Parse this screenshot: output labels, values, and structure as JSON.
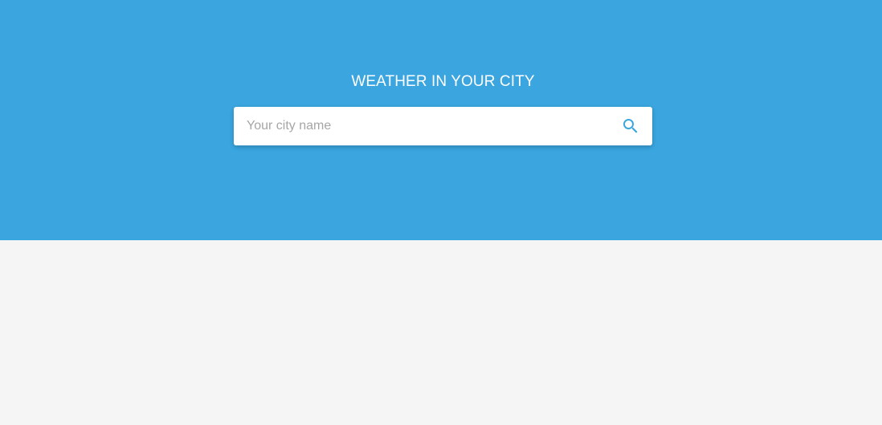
{
  "header": {
    "title": "WEATHER IN YOUR CITY"
  },
  "search": {
    "placeholder": "Your city name",
    "value": "",
    "button_icon": "search-icon"
  },
  "colors": {
    "accent": "#3aa5df",
    "background": "#f5f5f5",
    "card": "#ffffff",
    "title_text": "#ffffff",
    "placeholder_text": "#a6a6a6"
  }
}
